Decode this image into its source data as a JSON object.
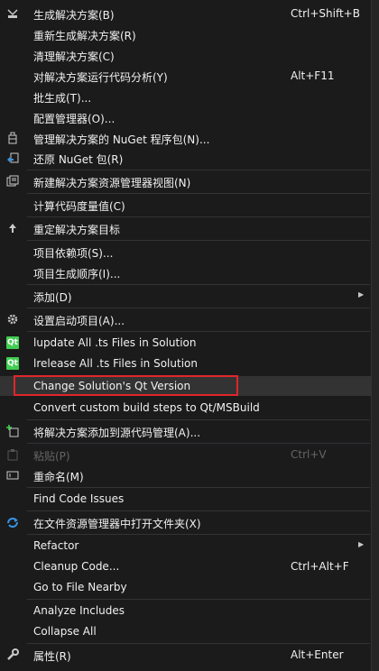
{
  "menu": {
    "build_solution": {
      "label": "生成解决方案(B)",
      "shortcut": "Ctrl+Shift+B"
    },
    "rebuild_solution": {
      "label": "重新生成解决方案(R)"
    },
    "clean_solution": {
      "label": "清理解决方案(C)"
    },
    "code_analysis": {
      "label": "对解决方案运行代码分析(Y)",
      "shortcut": "Alt+F11"
    },
    "batch_build": {
      "label": "批生成(T)..."
    },
    "config_manager": {
      "label": "配置管理器(O)..."
    },
    "manage_nuget": {
      "label": "管理解决方案的 NuGet 程序包(N)..."
    },
    "restore_nuget": {
      "label": "还原 NuGet 包(R)"
    },
    "new_solution_view": {
      "label": "新建解决方案资源管理器视图(N)"
    },
    "code_metrics": {
      "label": "计算代码度量值(C)"
    },
    "retarget": {
      "label": "重定解决方案目标"
    },
    "project_deps": {
      "label": "项目依赖项(S)..."
    },
    "build_order": {
      "label": "项目生成顺序(I)..."
    },
    "add": {
      "label": "添加(D)"
    },
    "set_startup": {
      "label": "设置启动项目(A)..."
    },
    "lupdate": {
      "label": "lupdate All .ts Files in Solution"
    },
    "lrelease": {
      "label": "lrelease All .ts Files in Solution"
    },
    "change_qt": {
      "label": "Change Solution's Qt Version"
    },
    "convert_qt": {
      "label": "Convert custom build steps to Qt/MSBuild"
    },
    "add_source_control": {
      "label": "将解决方案添加到源代码管理(A)..."
    },
    "paste": {
      "label": "粘贴(P)",
      "shortcut": "Ctrl+V"
    },
    "rename": {
      "label": "重命名(M)"
    },
    "find_issues": {
      "label": "Find Code Issues"
    },
    "open_folder": {
      "label": "在文件资源管理器中打开文件夹(X)"
    },
    "refactor": {
      "label": "Refactor"
    },
    "cleanup": {
      "label": "Cleanup Code...",
      "shortcut": "Ctrl+Alt+F"
    },
    "go_nearby": {
      "label": "Go to File Nearby"
    },
    "analyze_includes": {
      "label": "Analyze Includes"
    },
    "collapse_all": {
      "label": "Collapse All"
    },
    "properties": {
      "label": "属性(R)",
      "shortcut": "Alt+Enter"
    }
  },
  "icons": {
    "qt_badge": "Qt"
  },
  "colors": {
    "background": "#1b1b1c",
    "highlight_border": "#e0262b",
    "qt_green": "#41cd52"
  }
}
